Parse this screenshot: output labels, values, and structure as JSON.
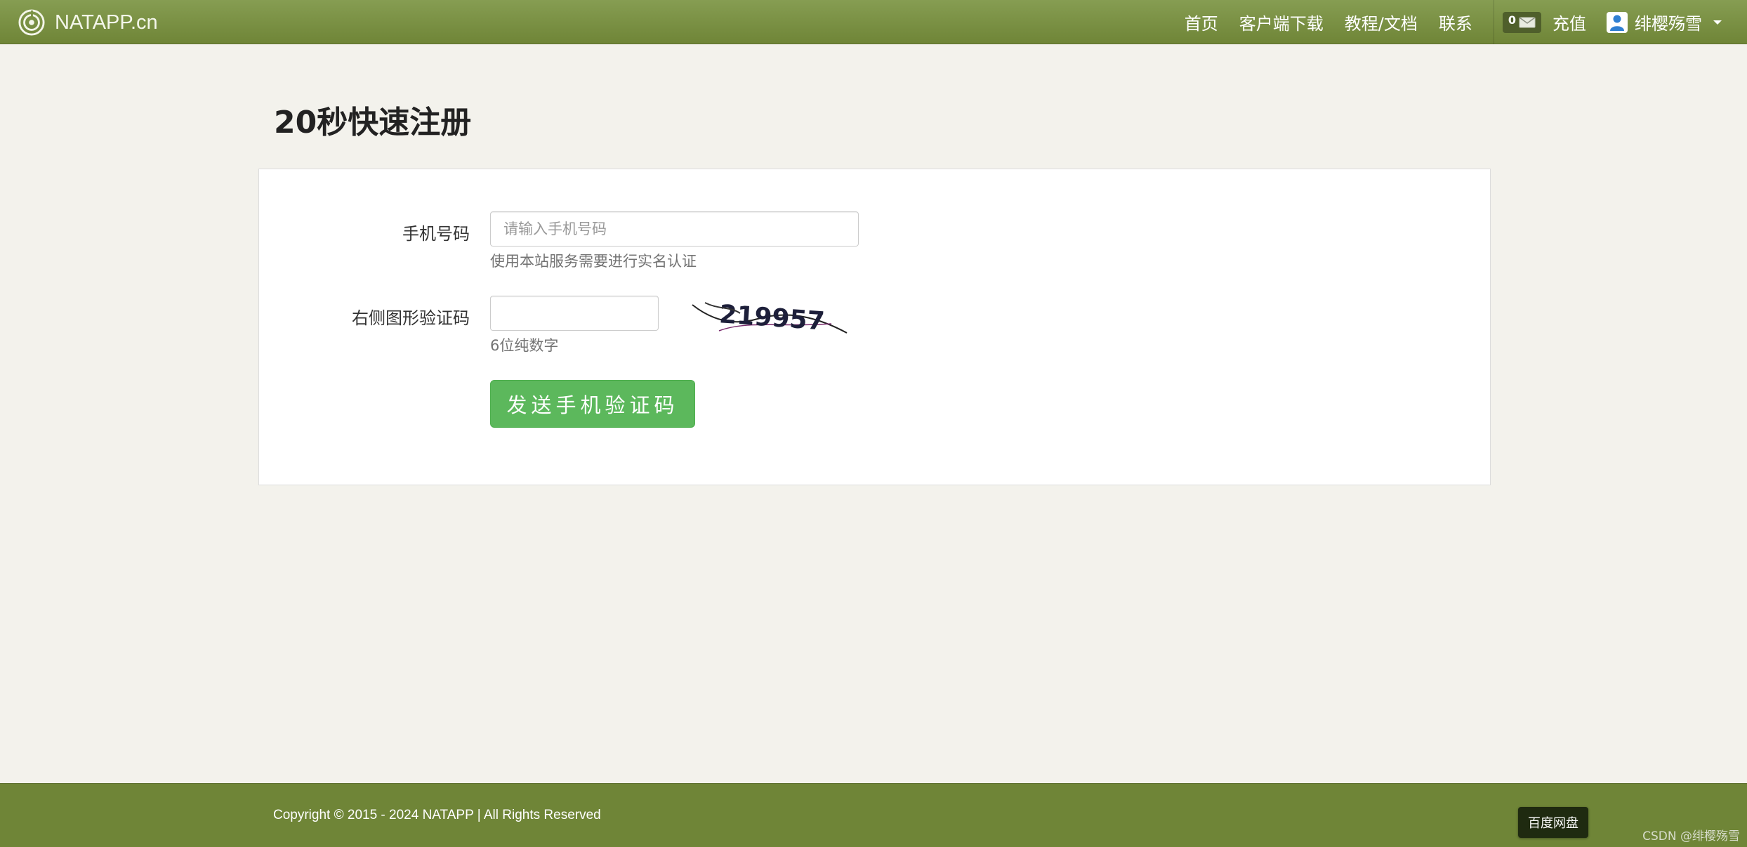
{
  "brand": {
    "name": "NATAPP.cn"
  },
  "nav": {
    "links": [
      "首页",
      "客户端下载",
      "教程/文档",
      "联系"
    ],
    "message_count": "0",
    "recharge": "充值",
    "username": "绯樱殇雪"
  },
  "page": {
    "title": "20秒快速注册"
  },
  "form": {
    "phone_label": "手机号码",
    "phone_placeholder": "请输入手机号码",
    "phone_value": "",
    "phone_help": "使用本站服务需要进行实名认证",
    "captcha_label": "右侧图形验证码",
    "captcha_value": "",
    "captcha_help": "6位纯数字",
    "captcha_image_text": "219957",
    "submit_label": "发送手机验证码"
  },
  "footer": {
    "copyright": "Copyright © 2015 - 2024 NATAPP  |  All Rights Reserved",
    "baidu_button": "百度网盘",
    "watermark": "CSDN @绯樱殇雪"
  },
  "colors": {
    "nav_green": "#6f8537",
    "button_green": "#5cb85c",
    "background": "#f3f2ec"
  }
}
